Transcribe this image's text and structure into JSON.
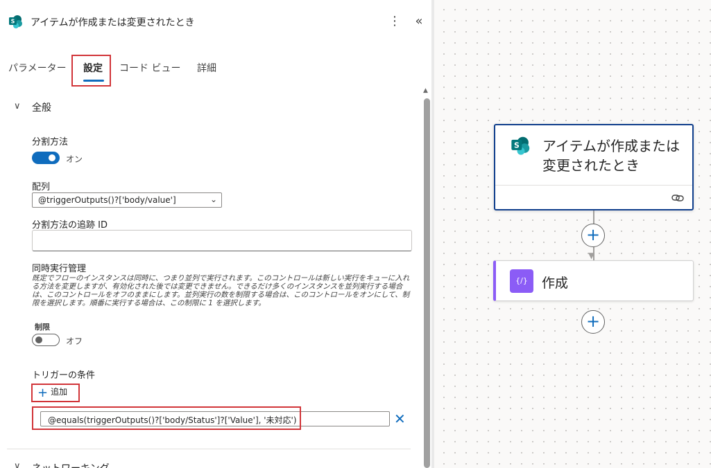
{
  "panel": {
    "title": "アイテムが作成または変更されたとき",
    "more_glyph": "⋮",
    "collapse_glyph": "«",
    "tabs": [
      {
        "label": "パラメーター"
      },
      {
        "label": "設定"
      },
      {
        "label": "コード ビュー"
      },
      {
        "label": "詳細"
      }
    ],
    "section_general": {
      "title": "全般",
      "split_on": {
        "label": "分割方法",
        "state": "オン",
        "enabled": true
      },
      "array": {
        "label": "配列",
        "value": "@triggerOutputs()?['body/value']"
      },
      "tracking_id": {
        "label": "分割方法の追跡 ID",
        "value": ""
      },
      "concurrency": {
        "label": "同時実行管理",
        "description": "既定でフローのインスタンスは同時に、つまり並列で実行されます。このコントロールは新しい実行をキューに入れる方法を変更しますが、有効化された後では変更できません。できるだけ多くのインスタンスを並列実行する場合は、このコントロールをオフのままにします。並列実行の数を制限する場合は、このコントロールをオンにして、制限を選択します。順番に実行する場合は、この制限に 1 を選択します。",
        "limit_label": "制限",
        "state": "オフ",
        "enabled": false
      },
      "trigger_conditions": {
        "label": "トリガーの条件",
        "add_label": "追加",
        "condition": "@equals(triggerOutputs()?['body/Status']?['Value'], '未対応')"
      }
    },
    "section_networking": {
      "title": "ネットワーキング"
    }
  },
  "canvas": {
    "trigger_card": {
      "title": "アイテムが作成または変更されたとき"
    },
    "action_card": {
      "title": "作成",
      "icon_glyph": "{/}"
    }
  },
  "colors": {
    "accent": "#0f6cbd",
    "highlight": "#d13438",
    "compose": "#8b5cf6",
    "sharepoint": "#038387"
  }
}
